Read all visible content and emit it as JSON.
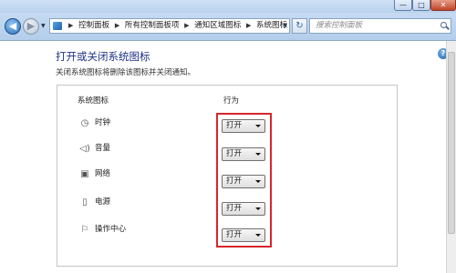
{
  "window": {
    "minimize_glyph": "—",
    "maximize_glyph": "□",
    "close_glyph": "✕"
  },
  "nav": {
    "back_glyph": "◀",
    "forward_glyph": "▶",
    "breadcrumb": [
      "控制面板",
      "所有控制面板项",
      "通知区域图标",
      "系统图标"
    ],
    "search_placeholder": "搜索控制面板"
  },
  "page": {
    "heading": "打开或关闭系统图标",
    "description": "关闭系统图标将删除该图标并关闭通知。",
    "help_glyph": "?"
  },
  "table": {
    "col_icon": "系统图标",
    "col_behavior": "行为",
    "rows": [
      {
        "label": "时钟",
        "icon": "clock-icon",
        "value": "打开"
      },
      {
        "label": "音量",
        "icon": "speaker-icon",
        "value": "打开"
      },
      {
        "label": "网络",
        "icon": "network-icon",
        "value": "打开"
      },
      {
        "label": "电源",
        "icon": "battery-icon",
        "value": "打开"
      },
      {
        "label": "操作中心",
        "icon": "flag-icon",
        "value": "打开"
      }
    ]
  },
  "colors": {
    "heading": "#1e3287",
    "highlight_border": "#d6262b"
  }
}
